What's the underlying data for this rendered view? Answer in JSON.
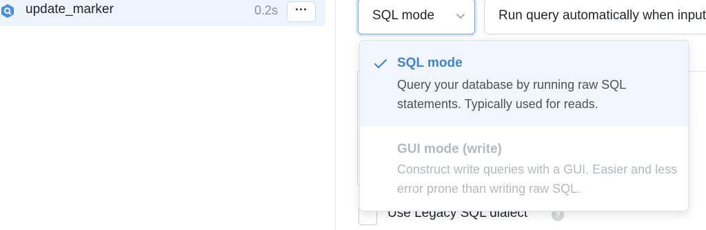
{
  "query": {
    "name": "update_marker",
    "duration": "0.2s",
    "more_label": "···",
    "icon": "query-icon"
  },
  "toolbar": {
    "mode_select_value": "SQL mode",
    "run_select_value": "Run query automatically when inputs change"
  },
  "mode_menu": {
    "options": [
      {
        "title": "SQL mode",
        "description": "Query your database by running raw SQL statements. Typically used for reads.",
        "selected": true,
        "disabled": false
      },
      {
        "title": "GUI mode (write)",
        "description": "Construct write queries with a GUI. Easier and less error prone than writing raw SQL.",
        "selected": false,
        "disabled": true
      }
    ]
  },
  "options": {
    "legacy_sql_label": "Use Legacy SQL dialect",
    "legacy_sql_checked": false
  },
  "colors": {
    "accent": "#3b86d6",
    "selected_bg": "#f1f6fc",
    "query_row_bg": "#eef4fb",
    "disabled_text": "#b4b9bf"
  }
}
